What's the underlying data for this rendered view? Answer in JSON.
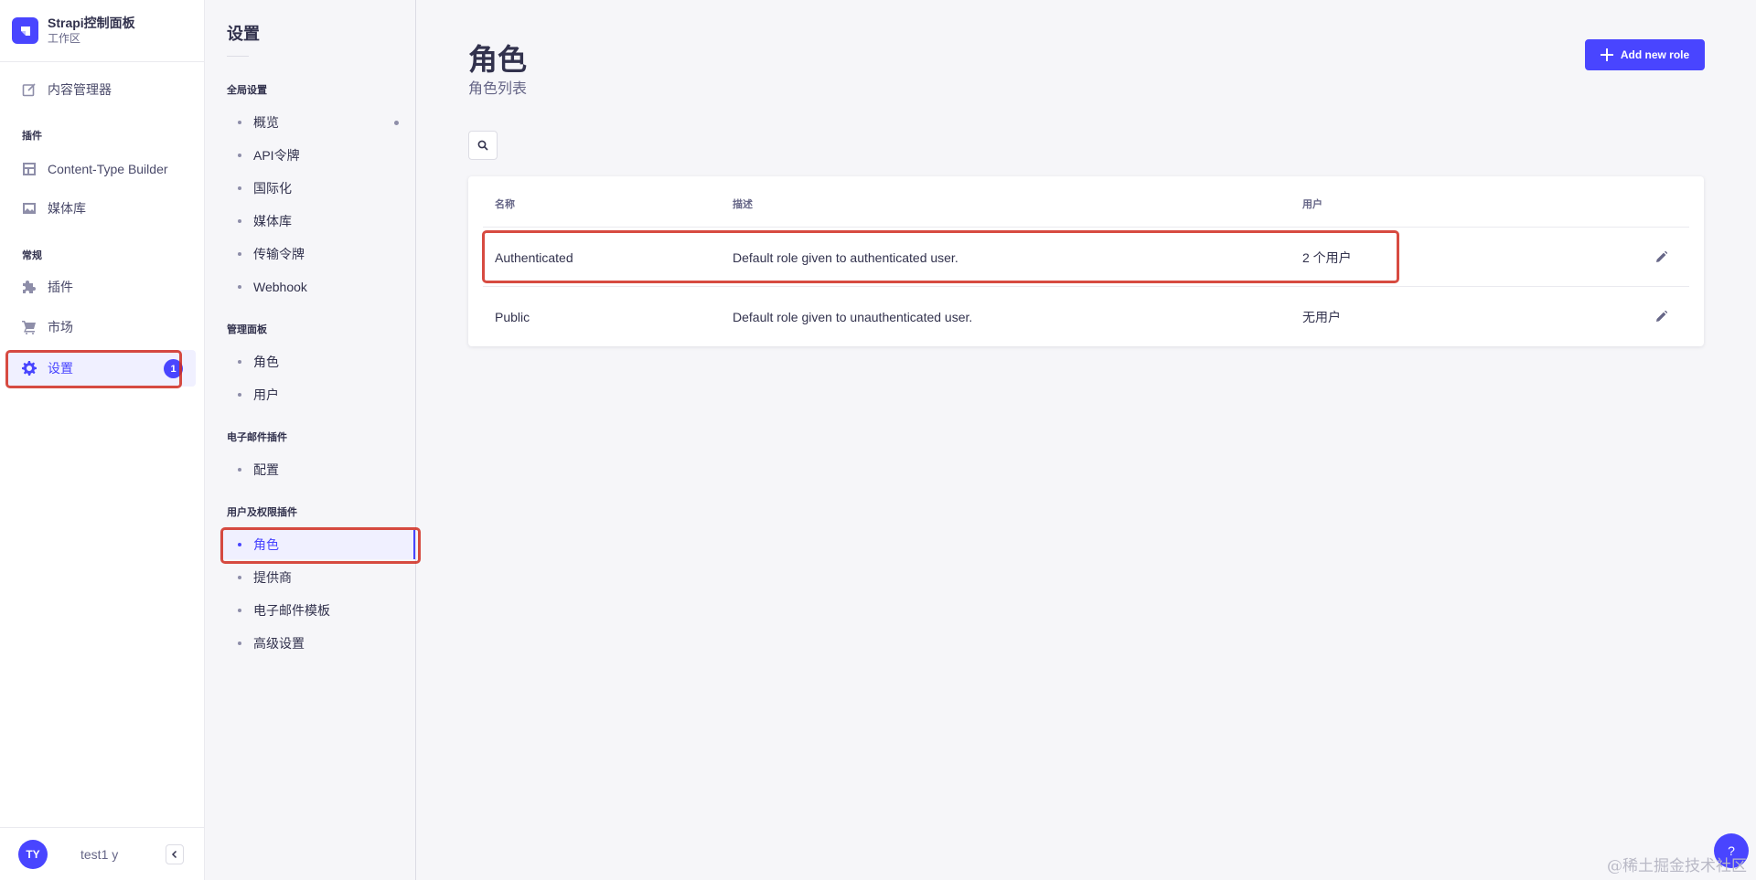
{
  "brand": {
    "title": "Strapi控制面板",
    "subtitle": "工作区"
  },
  "mainnav": {
    "content_manager": "内容管理器",
    "plugins_section": "插件",
    "content_type_builder": "Content-Type Builder",
    "media_library": "媒体库",
    "general_section": "常规",
    "plugins": "插件",
    "marketplace": "市场",
    "settings": "设置",
    "settings_badge": "1"
  },
  "user": {
    "initials": "TY",
    "name": "test1 y"
  },
  "subnav": {
    "title": "设置",
    "global_section": "全局设置",
    "global_items": [
      "概览",
      "API令牌",
      "国际化",
      "媒体库",
      "传输令牌",
      "Webhook"
    ],
    "admin_section": "管理面板",
    "admin_items": [
      "角色",
      "用户"
    ],
    "email_section": "电子邮件插件",
    "email_items": [
      "配置"
    ],
    "up_section": "用户及权限插件",
    "up_items": [
      "角色",
      "提供商",
      "电子邮件模板",
      "高级设置"
    ]
  },
  "header": {
    "title": "角色",
    "subtitle": "角色列表",
    "add_button": "Add new role"
  },
  "table": {
    "columns": [
      "名称",
      "描述",
      "用户"
    ],
    "rows": [
      {
        "name": "Authenticated",
        "description": "Default role given to authenticated user.",
        "users": "2 个用户"
      },
      {
        "name": "Public",
        "description": "Default role given to unauthenticated user.",
        "users": "无用户"
      }
    ]
  },
  "help": "?",
  "watermark": "@稀土掘金技术社区",
  "colors": {
    "primary": "#4945ff",
    "highlight": "#d02b20"
  }
}
